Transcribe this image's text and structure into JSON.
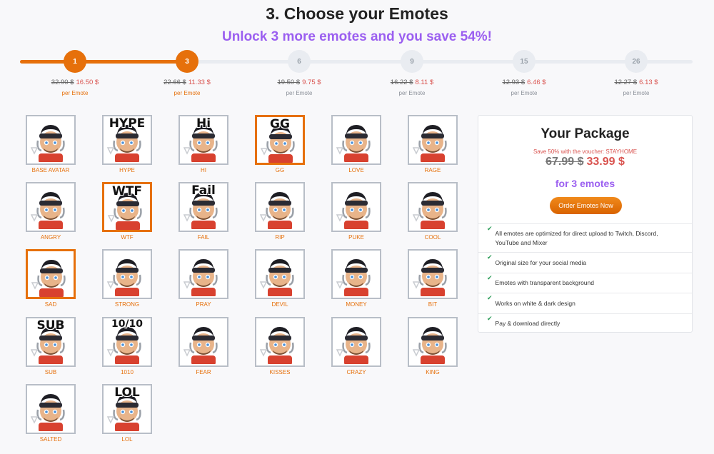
{
  "heading": {
    "title": "3. Choose your Emotes",
    "subtitle": "Unlock 3 more emotes and you save 54%!"
  },
  "steps": [
    {
      "count": "1",
      "old_price": "32.90 $",
      "new_price": "16.50 $",
      "per": "per Emote",
      "active": true
    },
    {
      "count": "3",
      "old_price": "22.66 $",
      "new_price": "11.33 $",
      "per": "per Emote",
      "active": true
    },
    {
      "count": "6",
      "old_price": "19.50 $",
      "new_price": "9.75 $",
      "per": "per Emote",
      "active": false
    },
    {
      "count": "9",
      "old_price": "16.22 $",
      "new_price": "8.11 $",
      "per": "per Emote",
      "active": false
    },
    {
      "count": "15",
      "old_price": "12.93 $",
      "new_price": "6.46 $",
      "per": "per Emote",
      "active": false
    },
    {
      "count": "26",
      "old_price": "12.27 $",
      "new_price": "6.13 $",
      "per": "per Emote",
      "active": false
    }
  ],
  "emotes": [
    {
      "label": "BASE AVATAR",
      "text": "",
      "selected": false
    },
    {
      "label": "HYPE",
      "text": "HYPE",
      "selected": false
    },
    {
      "label": "HI",
      "text": "Hi",
      "selected": false
    },
    {
      "label": "GG",
      "text": "GG",
      "selected": true
    },
    {
      "label": "LOVE",
      "text": "",
      "selected": false
    },
    {
      "label": "RAGE",
      "text": "",
      "selected": false
    },
    {
      "label": "ANGRY",
      "text": "",
      "selected": false
    },
    {
      "label": "WTF",
      "text": "WTF",
      "selected": true
    },
    {
      "label": "FAIL",
      "text": "Fail",
      "selected": false
    },
    {
      "label": "RIP",
      "text": "",
      "selected": false
    },
    {
      "label": "PUKE",
      "text": "",
      "selected": false
    },
    {
      "label": "COOL",
      "text": "",
      "selected": false
    },
    {
      "label": "SAD",
      "text": "",
      "selected": true
    },
    {
      "label": "STRONG",
      "text": "",
      "selected": false
    },
    {
      "label": "PRAY",
      "text": "",
      "selected": false
    },
    {
      "label": "DEVIL",
      "text": "",
      "selected": false
    },
    {
      "label": "MONEY",
      "text": "",
      "selected": false
    },
    {
      "label": "BIT",
      "text": "",
      "selected": false
    },
    {
      "label": "SUB",
      "text": "SUB",
      "selected": false
    },
    {
      "label": "1010",
      "text": "10/10",
      "selected": false
    },
    {
      "label": "FEAR",
      "text": "",
      "selected": false
    },
    {
      "label": "KISSES",
      "text": "",
      "selected": false
    },
    {
      "label": "CRAZY",
      "text": "",
      "selected": false
    },
    {
      "label": "KING",
      "text": "",
      "selected": false
    },
    {
      "label": "SALTED",
      "text": "",
      "selected": false
    },
    {
      "label": "LOL",
      "text": "LOL",
      "selected": false
    }
  ],
  "package": {
    "title": "Your Package",
    "voucher": "Save 50% with the voucher: STAYHOME",
    "old_price": "67.99 $",
    "new_price": "33.99 $",
    "count_text": "for 3 emotes",
    "order_label": "Order Emotes Now",
    "features": [
      "All emotes are optimized for direct upload to Twitch, Discord, YouTube and Mixer",
      "Original size for your social media",
      "Emotes with transparent background",
      "Works on white & dark design",
      "Pay & download directly"
    ]
  },
  "colors": {
    "accent": "#e6700b",
    "purple": "#9b5ff0",
    "sale_red": "#d9534f",
    "check_green": "#2e9d5a"
  }
}
